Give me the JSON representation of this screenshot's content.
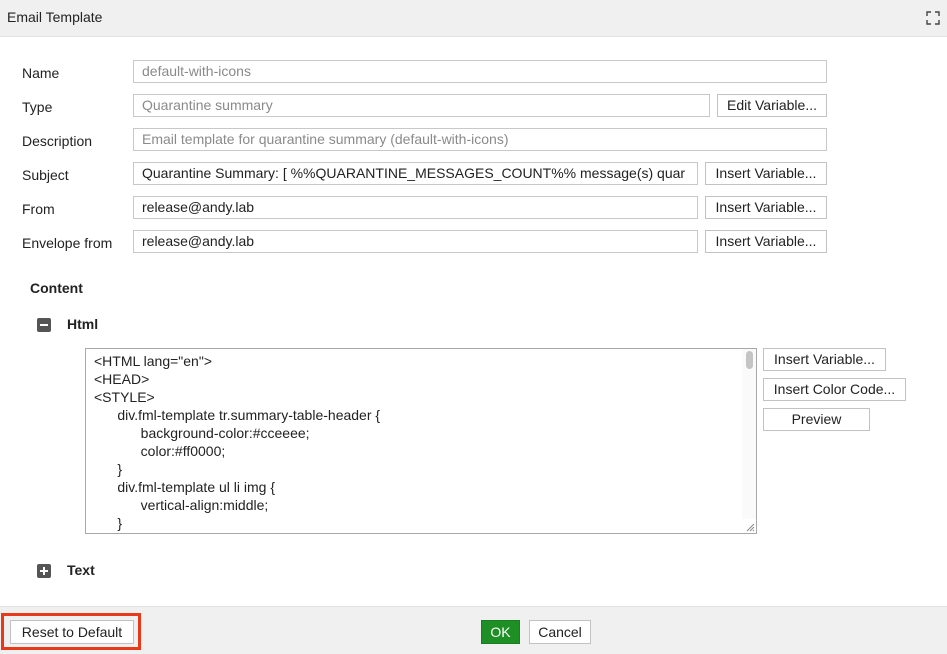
{
  "window": {
    "title": "Email Template",
    "expand_icon": "expand-icon"
  },
  "form": {
    "name": {
      "label": "Name",
      "value": "default-with-icons"
    },
    "type": {
      "label": "Type",
      "value": "Quarantine summary",
      "button": "Edit Variable..."
    },
    "description": {
      "label": "Description",
      "value": "Email template for quarantine summary (default-with-icons)"
    },
    "subject": {
      "label": "Subject",
      "value": "Quarantine Summary: [ %%QUARANTINE_MESSAGES_COUNT%% message(s) quar",
      "button": "Insert Variable..."
    },
    "from": {
      "label": "From",
      "value": "release@andy.lab",
      "button": "Insert Variable..."
    },
    "envelope_from": {
      "label": "Envelope from",
      "value": "release@andy.lab",
      "button": "Insert Variable..."
    }
  },
  "content": {
    "heading": "Content",
    "html_section": {
      "label": "Html",
      "expanded": true,
      "code": "<HTML lang=\"en\">\n<HEAD>\n<STYLE>\n      div.fml-template tr.summary-table-header {\n            background-color:#cceeee;\n            color:#ff0000;\n      }\n      div.fml-template ul li img {\n            vertical-align:middle;\n      }",
      "buttons": {
        "insert_variable": "Insert Variable...",
        "insert_color_code": "Insert Color Code...",
        "preview": "Preview"
      }
    },
    "text_section": {
      "label": "Text",
      "expanded": false
    }
  },
  "footer": {
    "reset": "Reset to Default",
    "ok": "OK",
    "cancel": "Cancel",
    "ok_color": "#1e8f24",
    "highlight_color": "#e8391a"
  }
}
